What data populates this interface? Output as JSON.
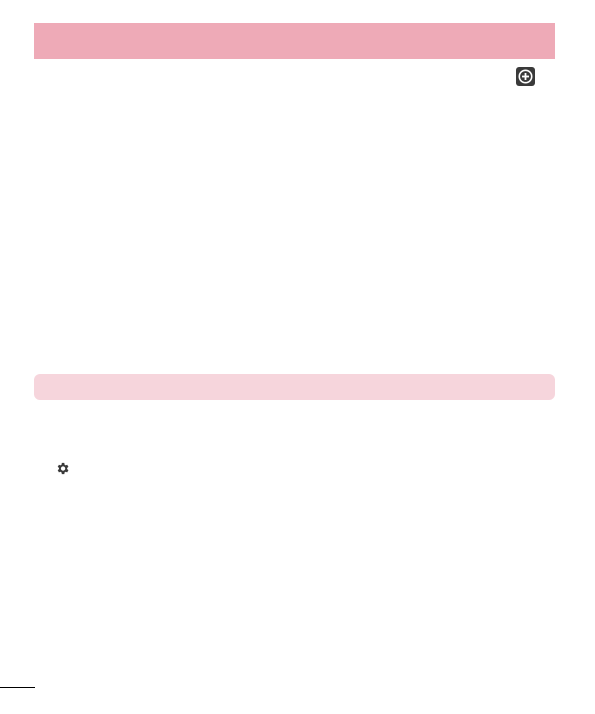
{
  "icons": {
    "add": "plus-circle-icon",
    "settings": "gear-icon"
  },
  "colors": {
    "section_header": "#eeaab7",
    "sub_header": "#f6d5dc",
    "icon_dark": "#3a3a3a"
  }
}
